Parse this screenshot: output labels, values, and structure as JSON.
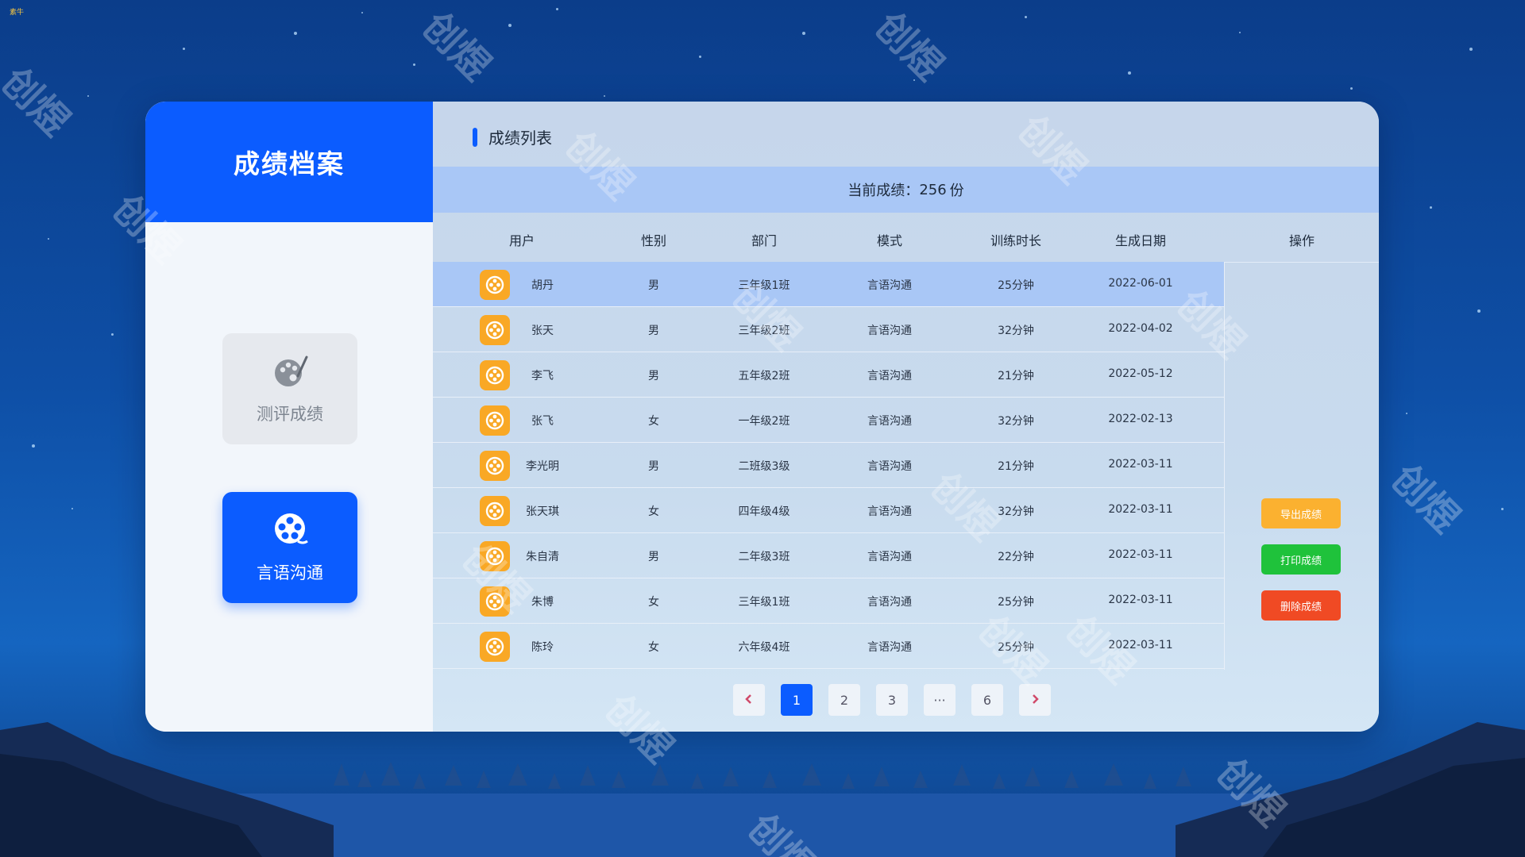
{
  "corner_tag": "素牛",
  "sidebar": {
    "title": "成绩档案",
    "items": [
      {
        "label": "测评成绩",
        "icon": "palette-icon",
        "active": false
      },
      {
        "label": "言语沟通",
        "icon": "film-reel-icon",
        "active": true
      }
    ]
  },
  "main": {
    "title": "成绩列表",
    "summary_label": "当前成绩：",
    "summary_count": "256",
    "summary_unit": "份",
    "columns": [
      "用户",
      "性别",
      "部门",
      "模式",
      "训练时长",
      "生成日期",
      "操作"
    ],
    "rows": [
      {
        "name": "胡丹",
        "gender": "男",
        "dept": "三年级1班",
        "mode": "言语沟通",
        "duration": "25分钟",
        "date": "2022-06-01"
      },
      {
        "name": "张天",
        "gender": "男",
        "dept": "三年级2班",
        "mode": "言语沟通",
        "duration": "32分钟",
        "date": "2022-04-02"
      },
      {
        "name": "李飞",
        "gender": "男",
        "dept": "五年级2班",
        "mode": "言语沟通",
        "duration": "21分钟",
        "date": "2022-05-12"
      },
      {
        "name": "张飞",
        "gender": "女",
        "dept": "一年级2班",
        "mode": "言语沟通",
        "duration": "32分钟",
        "date": "2022-02-13"
      },
      {
        "name": "李光明",
        "gender": "男",
        "dept": "二班级3级",
        "mode": "言语沟通",
        "duration": "21分钟",
        "date": "2022-03-11"
      },
      {
        "name": "张天琪",
        "gender": "女",
        "dept": "四年级4级",
        "mode": "言语沟通",
        "duration": "32分钟",
        "date": "2022-03-11"
      },
      {
        "name": "朱自清",
        "gender": "男",
        "dept": "二年级3班",
        "mode": "言语沟通",
        "duration": "22分钟",
        "date": "2022-03-11"
      },
      {
        "name": "朱博",
        "gender": "女",
        "dept": "三年级1班",
        "mode": "言语沟通",
        "duration": "25分钟",
        "date": "2022-03-11"
      },
      {
        "name": "陈玲",
        "gender": "女",
        "dept": "六年级4班",
        "mode": "言语沟通",
        "duration": "25分钟",
        "date": "2022-03-11"
      }
    ],
    "actions": {
      "export": "导出成绩",
      "print": "打印成绩",
      "delete": "删除成绩"
    },
    "pagination": {
      "prev_icon": "chevron-left-icon",
      "pages": [
        "1",
        "2",
        "3",
        "···",
        "6"
      ],
      "current": "1",
      "next_icon": "chevron-right-icon"
    }
  },
  "watermark_text": "创煜",
  "colors": {
    "accent": "#0b5cff",
    "export": "#fbb130",
    "print": "#1fc23b",
    "delete": "#f04a24",
    "avatar": "#f9a825"
  }
}
